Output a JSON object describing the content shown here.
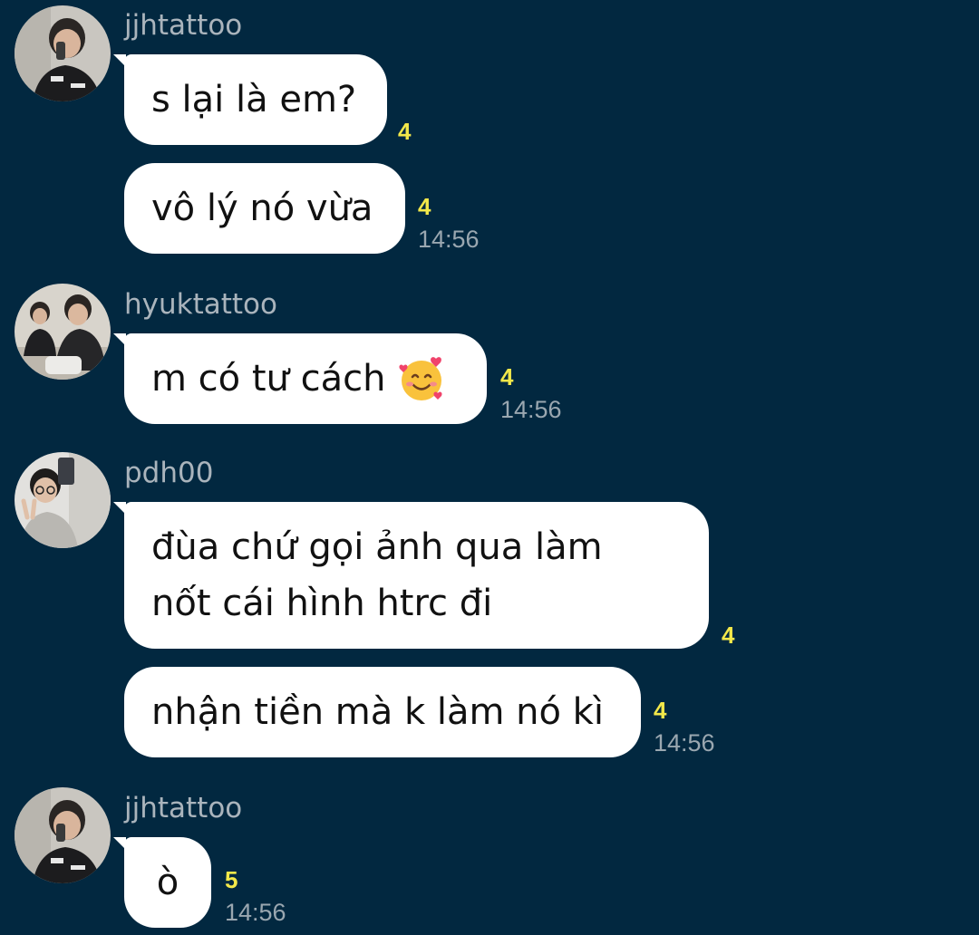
{
  "messages": [
    {
      "sender": "jjhtattoo",
      "avatar_icon": "avatar-jjhtattoo",
      "bubbles": [
        {
          "text": "s lại là em?",
          "reads": "4",
          "time": ""
        },
        {
          "text": "vô lý nó vừa",
          "reads": "4",
          "time": "14:56"
        }
      ]
    },
    {
      "sender": "hyuktattoo",
      "avatar_icon": "avatar-hyuktattoo",
      "bubbles": [
        {
          "text": "m có tư cách",
          "emoji": "smiling-face-with-hearts-emoji",
          "reads": "4",
          "time": "14:56"
        }
      ]
    },
    {
      "sender": "pdh00",
      "avatar_icon": "avatar-pdh00",
      "bubbles": [
        {
          "lines": [
            "đùa chứ gọi ảnh qua làm",
            "nốt cái hình htrc đi"
          ],
          "reads": "4",
          "time": ""
        },
        {
          "text": "nhận tiền mà k làm nó kì",
          "reads": "4",
          "time": "14:56"
        }
      ]
    },
    {
      "sender": "jjhtattoo",
      "avatar_icon": "avatar-jjhtattoo",
      "bubbles": [
        {
          "text": "ò",
          "reads": "5",
          "time": "14:56"
        }
      ]
    }
  ],
  "colors": {
    "background": "#022840",
    "bubble": "#ffffff",
    "read_count": "#f3e84a",
    "timestamp": "#9aa7b0",
    "sender_name": "#aab4bc"
  }
}
